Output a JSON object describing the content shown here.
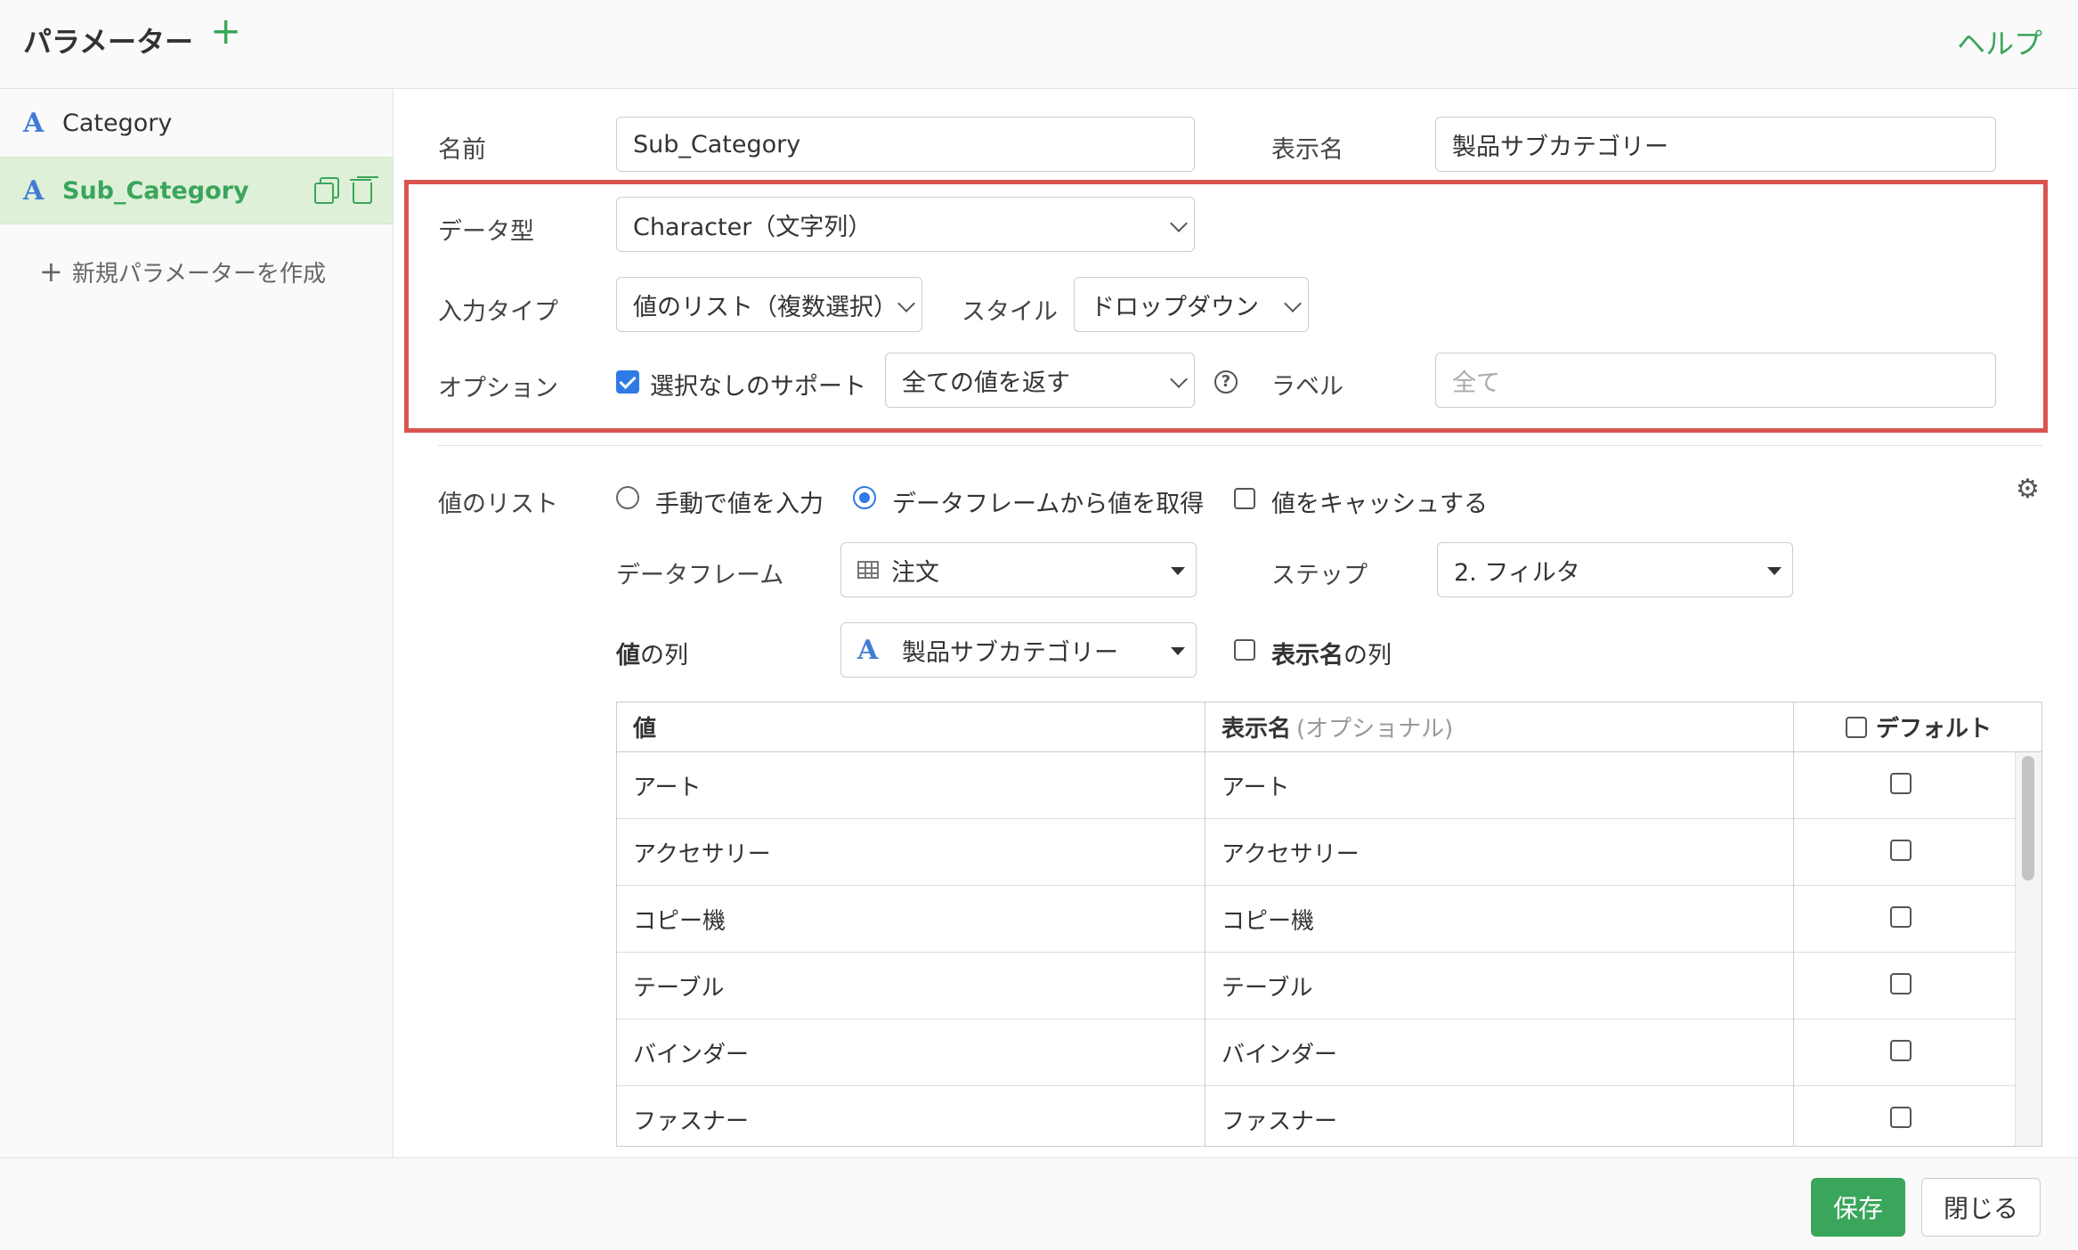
{
  "header": {
    "title": "パラメーター",
    "add_icon": "plus-icon",
    "help": "ヘルプ"
  },
  "sidebar": {
    "items": [
      {
        "label": "Category",
        "type_icon": "A"
      },
      {
        "label": "Sub_Category",
        "type_icon": "A",
        "active": true
      }
    ],
    "new_param": "新規パラメーターを作成"
  },
  "form": {
    "name_label": "名前",
    "name_value": "Sub_Category",
    "display_name_label": "表示名",
    "display_name_value": "製品サブカテゴリー",
    "data_type_label": "データ型",
    "data_type_value": "Character（文字列）",
    "input_type_label": "入力タイプ",
    "input_type_value": "値のリスト（複数選択）",
    "style_label": "スタイル",
    "style_value": "ドロップダウン",
    "option_label": "オプション",
    "support_none_label": "選択なしのサポート",
    "support_none_checked": true,
    "return_value": "全ての値を返す",
    "label_label": "ラベル",
    "label_placeholder": "全て",
    "highlight_color": "#d9534f"
  },
  "values_list": {
    "label": "値のリスト",
    "radio_manual": "手動で値を入力",
    "radio_dataframe": "データフレームから値を取得",
    "selected_radio": "dataframe",
    "cache_label": "値をキャッシュする",
    "dataframe_label": "データフレーム",
    "dataframe_value": "注文",
    "step_label": "ステップ",
    "step_value": "2. フィルタ",
    "value_col_label_bold": "値",
    "value_col_label_rest": "の列",
    "value_col_value": "製品サブカテゴリー",
    "display_col_label_bold": "表示名",
    "display_col_label_rest": "の列"
  },
  "table": {
    "headers": {
      "value": "値",
      "display": "表示名",
      "display_optional": "(オプショナル)",
      "default": "デフォルト"
    },
    "rows": [
      {
        "value": "アート",
        "display": "アート",
        "default": false
      },
      {
        "value": "アクセサリー",
        "display": "アクセサリー",
        "default": false
      },
      {
        "value": "コピー機",
        "display": "コピー機",
        "default": false
      },
      {
        "value": "テーブル",
        "display": "テーブル",
        "default": false
      },
      {
        "value": "バインダー",
        "display": "バインダー",
        "default": false
      },
      {
        "value": "ファスナー",
        "display": "ファスナー",
        "default": false
      }
    ]
  },
  "footer": {
    "save": "保存",
    "close": "閉じる"
  },
  "colors": {
    "accent_green": "#3aa65b",
    "accent_blue": "#2f7be5",
    "icon_blue": "#3f7bd6"
  }
}
